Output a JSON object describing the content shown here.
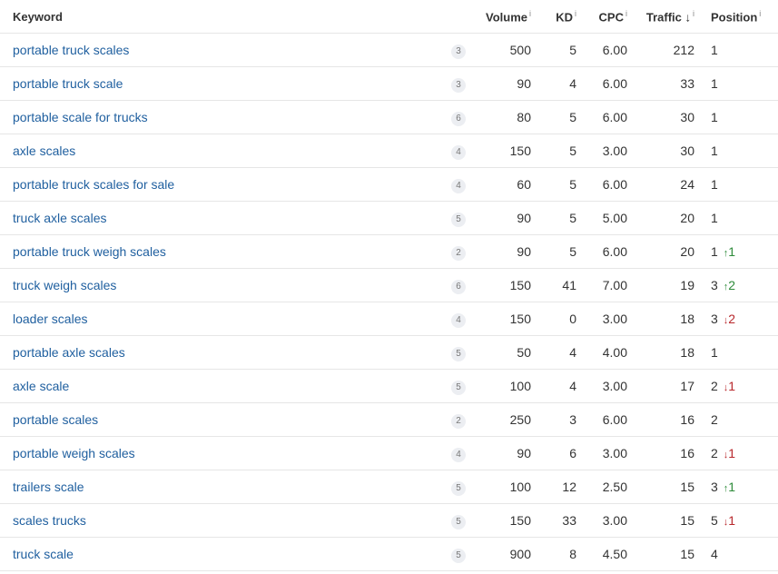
{
  "columns": {
    "keyword": "Keyword",
    "volume": "Volume",
    "kd": "KD",
    "cpc": "CPC",
    "traffic": "Traffic",
    "traffic_sort": "↓",
    "position": "Position",
    "info": "i"
  },
  "colors": {
    "link": "#1f5f9f",
    "up": "#2e8b3a",
    "down": "#b8282c"
  },
  "rows": [
    {
      "keyword": "portable truck scales",
      "serp": "3",
      "volume": "500",
      "kd": "5",
      "cpc": "6.00",
      "traffic": "212",
      "position": "1",
      "change": "",
      "dir": ""
    },
    {
      "keyword": "portable truck scale",
      "serp": "3",
      "volume": "90",
      "kd": "4",
      "cpc": "6.00",
      "traffic": "33",
      "position": "1",
      "change": "",
      "dir": ""
    },
    {
      "keyword": "portable scale for trucks",
      "serp": "6",
      "volume": "80",
      "kd": "5",
      "cpc": "6.00",
      "traffic": "30",
      "position": "1",
      "change": "",
      "dir": ""
    },
    {
      "keyword": "axle scales",
      "serp": "4",
      "volume": "150",
      "kd": "5",
      "cpc": "3.00",
      "traffic": "30",
      "position": "1",
      "change": "",
      "dir": ""
    },
    {
      "keyword": "portable truck scales for sale",
      "serp": "4",
      "volume": "60",
      "kd": "5",
      "cpc": "6.00",
      "traffic": "24",
      "position": "1",
      "change": "",
      "dir": ""
    },
    {
      "keyword": "truck axle scales",
      "serp": "5",
      "volume": "90",
      "kd": "5",
      "cpc": "5.00",
      "traffic": "20",
      "position": "1",
      "change": "",
      "dir": ""
    },
    {
      "keyword": "portable truck weigh scales",
      "serp": "2",
      "volume": "90",
      "kd": "5",
      "cpc": "6.00",
      "traffic": "20",
      "position": "1",
      "change": "1",
      "dir": "up"
    },
    {
      "keyword": "truck weigh scales",
      "serp": "6",
      "volume": "150",
      "kd": "41",
      "cpc": "7.00",
      "traffic": "19",
      "position": "3",
      "change": "2",
      "dir": "up"
    },
    {
      "keyword": "loader scales",
      "serp": "4",
      "volume": "150",
      "kd": "0",
      "cpc": "3.00",
      "traffic": "18",
      "position": "3",
      "change": "2",
      "dir": "down"
    },
    {
      "keyword": "portable axle scales",
      "serp": "5",
      "volume": "50",
      "kd": "4",
      "cpc": "4.00",
      "traffic": "18",
      "position": "1",
      "change": "",
      "dir": ""
    },
    {
      "keyword": "axle scale",
      "serp": "5",
      "volume": "100",
      "kd": "4",
      "cpc": "3.00",
      "traffic": "17",
      "position": "2",
      "change": "1",
      "dir": "down"
    },
    {
      "keyword": "portable scales",
      "serp": "2",
      "volume": "250",
      "kd": "3",
      "cpc": "6.00",
      "traffic": "16",
      "position": "2",
      "change": "",
      "dir": ""
    },
    {
      "keyword": "portable weigh scales",
      "serp": "4",
      "volume": "90",
      "kd": "6",
      "cpc": "3.00",
      "traffic": "16",
      "position": "2",
      "change": "1",
      "dir": "down"
    },
    {
      "keyword": "trailers scale",
      "serp": "5",
      "volume": "100",
      "kd": "12",
      "cpc": "2.50",
      "traffic": "15",
      "position": "3",
      "change": "1",
      "dir": "up"
    },
    {
      "keyword": "scales trucks",
      "serp": "5",
      "volume": "150",
      "kd": "33",
      "cpc": "3.00",
      "traffic": "15",
      "position": "5",
      "change": "1",
      "dir": "down"
    },
    {
      "keyword": "truck scale",
      "serp": "5",
      "volume": "900",
      "kd": "8",
      "cpc": "4.50",
      "traffic": "15",
      "position": "4",
      "change": "",
      "dir": ""
    }
  ]
}
